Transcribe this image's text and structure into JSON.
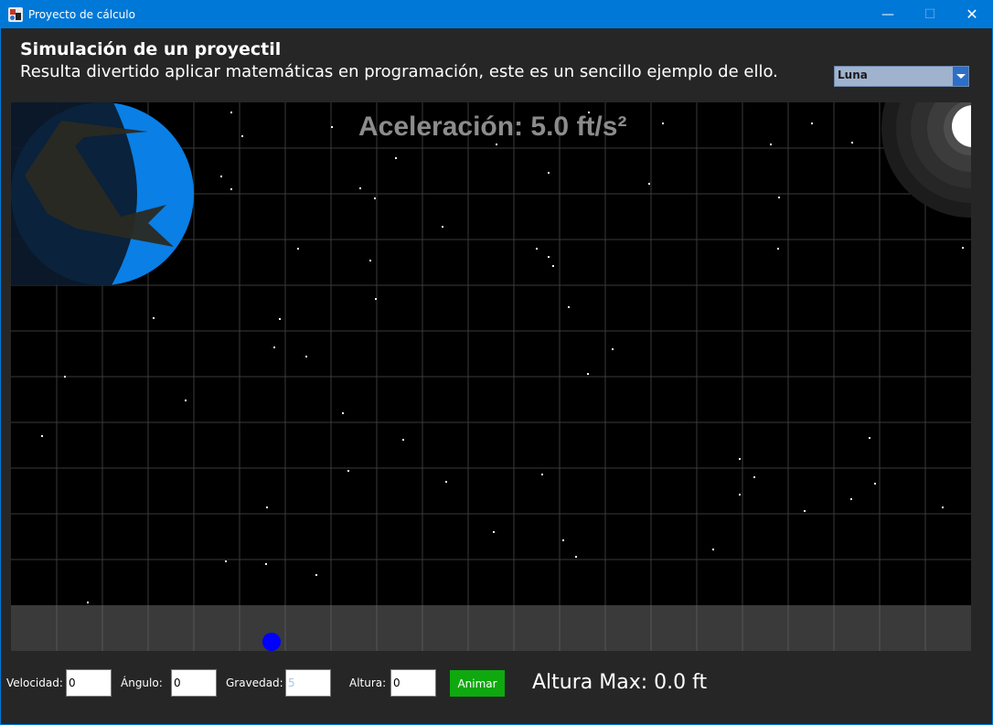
{
  "window": {
    "title": "Proyecto de cálculo",
    "minimize_glyph": "—",
    "maximize_glyph": "☐",
    "close_glyph": "✕"
  },
  "header": {
    "title": "Simulación de un proyectil",
    "subtitle": "Resulta divertido aplicar matemáticas en programación, este es un sencillo ejemplo de ello."
  },
  "body_select": {
    "value": "Luna"
  },
  "scene": {
    "acceleration_text": "Aceleración: 5.0 ft/s²",
    "sky_color": "#000000",
    "grid_color": "#3a3a3a",
    "ground_color": "#3a3a3a",
    "planet_color": "#0a7fe6",
    "moon_color": "#ffffff",
    "projectile_color": "#0000ff"
  },
  "controls": {
    "velocity_label": "Velocidad:",
    "velocity_value": "0",
    "angle_label": "Ángulo:",
    "angle_value": "0",
    "gravity_label": "Gravedad:",
    "gravity_value": "5",
    "height_label": "Altura:",
    "height_value": "0",
    "animate_label": "Animar",
    "max_height_text": "Altura Max: 0.0 ft"
  }
}
